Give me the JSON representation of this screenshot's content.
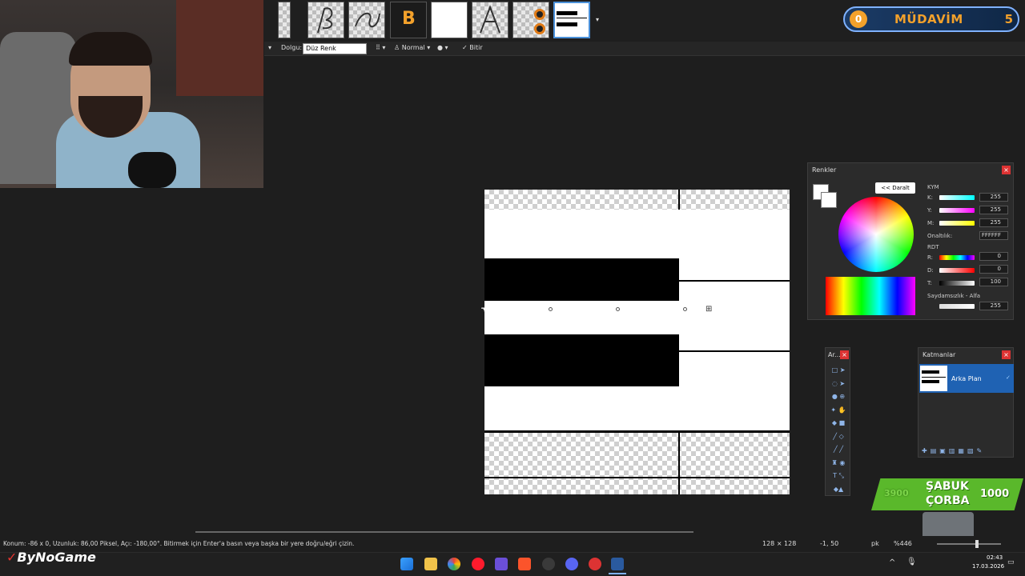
{
  "toolbar": {
    "fill_label": "Dolgu:",
    "fill_value": "Düz Renk",
    "blend_label": "Normal",
    "finish_label": "Bitir"
  },
  "badge": {
    "level": "0",
    "text": "MÜDAVİM",
    "score": "5"
  },
  "colors_panel": {
    "title": "Renkler",
    "toggle": "<< Daralt",
    "hsv_label": "KYM",
    "k_label": "K:",
    "k_value": "255",
    "y_label": "Y:",
    "y_value": "255",
    "m_label": "M:",
    "m_value": "255",
    "hex_label": "Onaltılık:",
    "hex_value": "FFFFFF",
    "rgb_label": "RDT",
    "r_label": "R:",
    "r_value": "0",
    "d_label": "D:",
    "d_value": "0",
    "t_label": "T:",
    "t_value": "100",
    "alpha_label": "Saydamsızlık - Alfa",
    "alpha_value": "255",
    "primary": "#ffffff"
  },
  "tools_panel": {
    "title": "Ar..."
  },
  "layers_panel": {
    "title": "Katmanlar",
    "layer_name": "Arka Plan"
  },
  "status": {
    "hint": "Konum: -86 x 0, Uzunluk: 86,00 Piksel, Açı: -180,00°. Bitirmek için Enter'a basın veya başka bir yere doğru/eğri çizin.",
    "size": "128 × 128",
    "coords": "-1, 50",
    "unit": "pk",
    "zoom": "%446"
  },
  "overlay": {
    "brand": "ByNoGame",
    "sabuk_left": "3900",
    "sabuk_title": "ŞABUK",
    "sabuk_sub": "ÇORBA",
    "sabuk_right": "1000"
  },
  "clock": {
    "time": "02:43",
    "date": "17.03.2026"
  }
}
